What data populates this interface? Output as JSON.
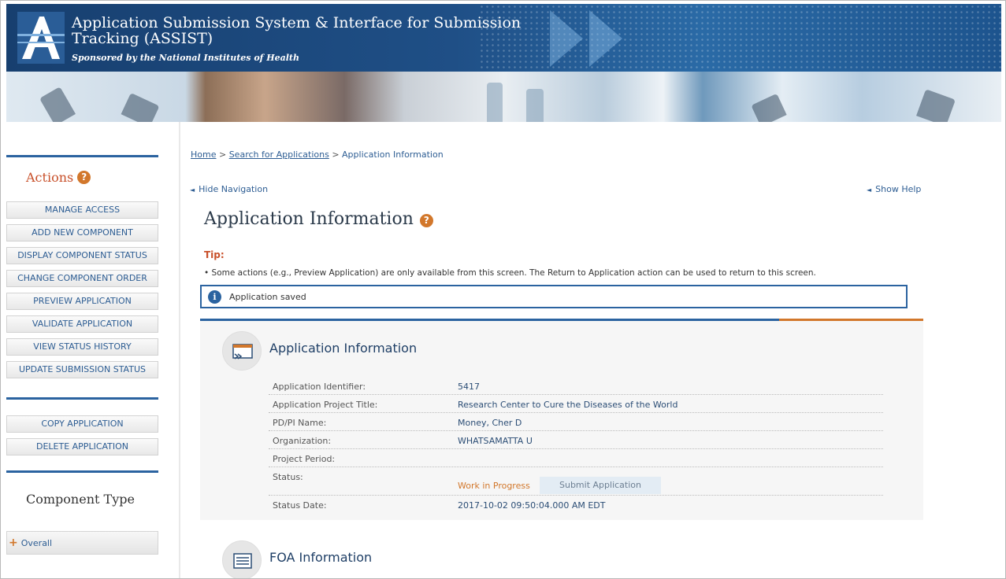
{
  "header": {
    "title": "Application Submission System & Interface for Submission Tracking (ASSIST)",
    "subtitle": "Sponsored by the National Institutes of Health"
  },
  "sidebar": {
    "actions_heading": "Actions",
    "action_buttons": [
      "MANAGE ACCESS",
      "ADD NEW COMPONENT",
      "DISPLAY COMPONENT STATUS",
      "CHANGE COMPONENT ORDER",
      "PREVIEW APPLICATION",
      "VALIDATE APPLICATION",
      "VIEW STATUS HISTORY",
      "UPDATE SUBMISSION STATUS"
    ],
    "secondary_buttons": [
      "COPY APPLICATION",
      "DELETE APPLICATION"
    ],
    "component_type_heading": "Component Type",
    "component_item": "Overall"
  },
  "breadcrumb": {
    "home": "Home",
    "sep": ">",
    "search": "Search for Applications",
    "current": "Application Information"
  },
  "nav": {
    "hide_navigation": "Hide Navigation",
    "show_help": "Show Help"
  },
  "page_title": "Application Information",
  "tip": {
    "label": "Tip:",
    "text": "Some actions (e.g., Preview Application) are only available from this screen. The Return to Application action can be used to return to this screen."
  },
  "alert": {
    "text": "Application saved"
  },
  "app_info": {
    "title": "Application Information",
    "rows": [
      {
        "label": "Application Identifier:",
        "value": "5417"
      },
      {
        "label": "Application Project Title:",
        "value": "Research Center to Cure the Diseases of the World"
      },
      {
        "label": "PD/PI Name:",
        "value": "Money, Cher D"
      },
      {
        "label": "Organization:",
        "value": "WHATSAMATTA U"
      },
      {
        "label": "Project Period:",
        "value": ""
      },
      {
        "label": "Status:",
        "value": "Work in Progress"
      },
      {
        "label": "Status Date:",
        "value": "2017-10-02 09:50:04.000 AM EDT"
      }
    ],
    "submit_button": "Submit Application"
  },
  "foa_info": {
    "title": "FOA Information"
  },
  "colors": {
    "primary_blue": "#2b63a0",
    "accent_orange": "#d2772b",
    "heading_orange": "#c8502a"
  }
}
